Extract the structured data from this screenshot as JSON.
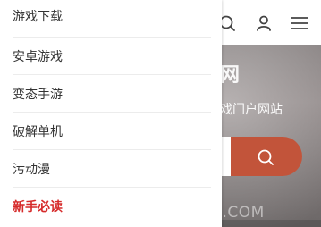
{
  "menu": {
    "items": [
      {
        "label": "游戏下载"
      },
      {
        "label": "安卓游戏"
      },
      {
        "label": "变态手游"
      },
      {
        "label": "破解单机"
      },
      {
        "label": "污动漫"
      },
      {
        "label": "新手必读",
        "highlight": true
      }
    ]
  },
  "header": {
    "icons": [
      "search-icon",
      "user-icon",
      "menu-icon"
    ]
  },
  "hero": {
    "headline_fragment": "网",
    "subtitle_fragment": "戏门户网站"
  },
  "search": {
    "button_icon": "search-icon",
    "button_color": "#c2543a"
  },
  "watermark": {
    "text": "应用 • HUACHUANGZS.COM"
  },
  "colors": {
    "highlight": "#d62b2b",
    "accent": "#c2543a"
  }
}
